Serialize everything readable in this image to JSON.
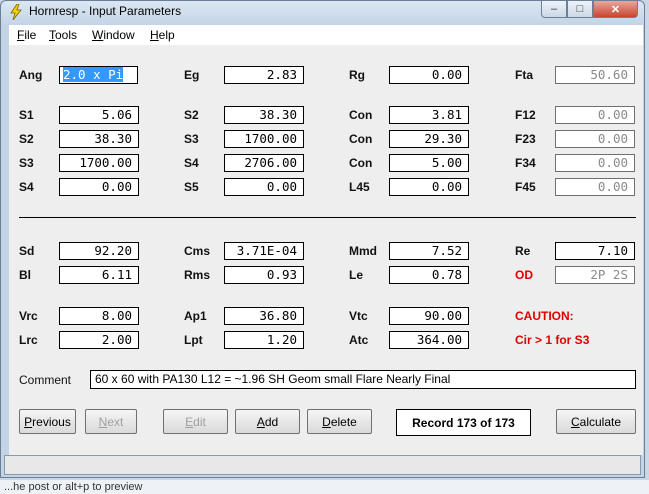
{
  "window": {
    "title": "Hornresp - Input Parameters",
    "min_glyph": "–",
    "max_glyph": "□",
    "close_glyph": "✕"
  },
  "background_text": "...he post or alt+p to preview",
  "menu": [
    {
      "accel": "F",
      "rest": "ile"
    },
    {
      "accel": "T",
      "rest": "ools"
    },
    {
      "accel": "W",
      "rest": "indow"
    },
    {
      "accel": "H",
      "rest": "elp"
    }
  ],
  "params": {
    "ang": {
      "label": "Ang",
      "value": "2.0 x Pi"
    },
    "eg": {
      "label": "Eg",
      "value": "2.83"
    },
    "rg": {
      "label": "Rg",
      "value": "0.00"
    },
    "fta": {
      "label": "Fta",
      "value": "50.60"
    },
    "s1": {
      "label": "S1",
      "value": "5.06"
    },
    "s2a": {
      "label": "S2",
      "value": "38.30"
    },
    "con1": {
      "label": "Con",
      "value": "3.81"
    },
    "f12": {
      "label": "F12",
      "value": "0.00"
    },
    "s2b": {
      "label": "S2",
      "value": "38.30"
    },
    "s3a": {
      "label": "S3",
      "value": "1700.00"
    },
    "con2": {
      "label": "Con",
      "value": "29.30"
    },
    "f23": {
      "label": "F23",
      "value": "0.00"
    },
    "s3b": {
      "label": "S3",
      "value": "1700.00"
    },
    "s4a": {
      "label": "S4",
      "value": "2706.00"
    },
    "con3": {
      "label": "Con",
      "value": "5.00"
    },
    "f34": {
      "label": "F34",
      "value": "0.00"
    },
    "s4b": {
      "label": "S4",
      "value": "0.00"
    },
    "s5": {
      "label": "S5",
      "value": "0.00"
    },
    "l45": {
      "label": "L45",
      "value": "0.00"
    },
    "f45": {
      "label": "F45",
      "value": "0.00"
    },
    "sd": {
      "label": "Sd",
      "value": "92.20"
    },
    "cms": {
      "label": "Cms",
      "value": "3.71E-04"
    },
    "mmd": {
      "label": "Mmd",
      "value": "7.52"
    },
    "re": {
      "label": "Re",
      "value": "7.10"
    },
    "bl": {
      "label": "Bl",
      "value": "6.11"
    },
    "rms": {
      "label": "Rms",
      "value": "0.93"
    },
    "le": {
      "label": "Le",
      "value": "0.78"
    },
    "od": {
      "label": "OD",
      "value": "2P 2S"
    },
    "vrc": {
      "label": "Vrc",
      "value": "8.00"
    },
    "ap1": {
      "label": "Ap1",
      "value": "36.80"
    },
    "vtc": {
      "label": "Vtc",
      "value": "90.00"
    },
    "lrc": {
      "label": "Lrc",
      "value": "2.00"
    },
    "lpt": {
      "label": "Lpt",
      "value": "1.20"
    },
    "atc": {
      "label": "Atc",
      "value": "364.00"
    }
  },
  "caution": {
    "title": "CAUTION:",
    "message": "Cir > 1 for S3"
  },
  "comment": {
    "label": "Comment",
    "value": "60 x 60 with PA130 L12 = ~1.96 SH Geom small Flare Nearly Final"
  },
  "buttons": {
    "previous": {
      "accel": "P",
      "rest": "revious"
    },
    "next": {
      "accel": "N",
      "rest": "ext"
    },
    "edit": {
      "accel": "E",
      "rest": "dit"
    },
    "add": {
      "accel": "A",
      "rest": "dd"
    },
    "delete": {
      "accel": "D",
      "rest": "elete"
    },
    "calculate": {
      "accel": "C",
      "rest": "alculate"
    }
  },
  "record": "Record 173 of 173",
  "colors": {
    "caution": "#e00000",
    "selection": "#3399ff",
    "close_button": "#c9452f"
  }
}
